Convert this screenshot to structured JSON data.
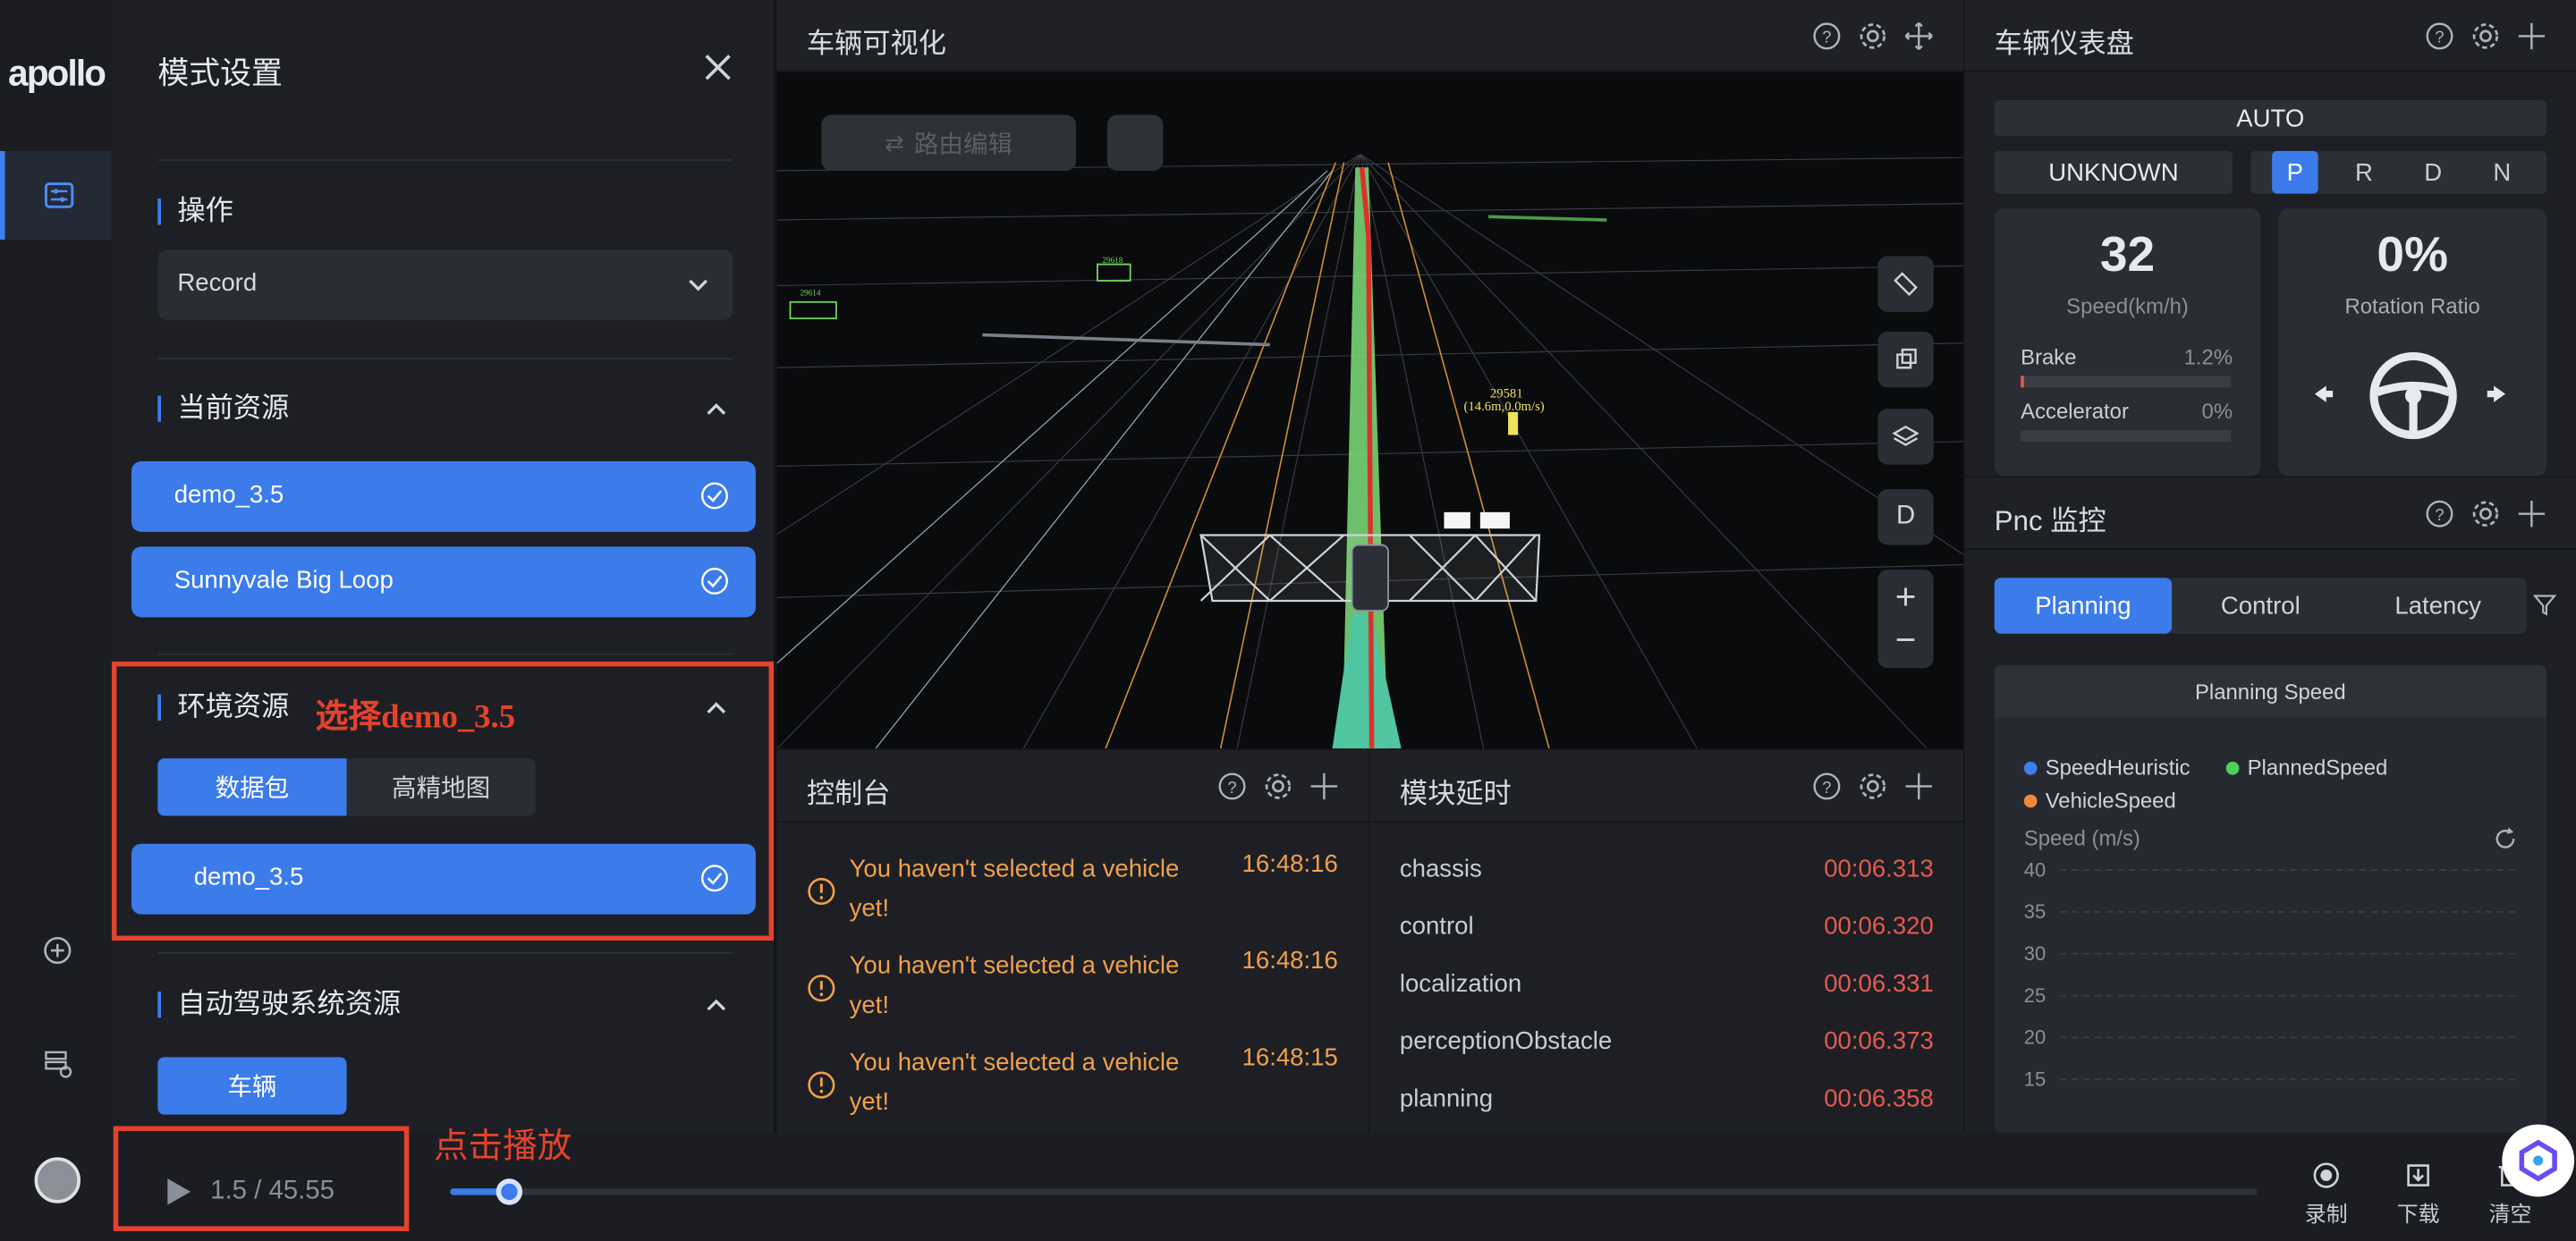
{
  "brand": {
    "logo": "apollo"
  },
  "mode_panel": {
    "title": "模式设置",
    "operation": {
      "title": "操作",
      "selected": "Record"
    },
    "current_resources": {
      "title": "当前资源",
      "items": [
        "demo_3.5",
        "Sunnyvale Big Loop"
      ]
    },
    "env_resources": {
      "title": "环境资源",
      "annotation": "选择demo_3.5",
      "tabs": [
        "数据包",
        "高精地图"
      ],
      "active_tab": "数据包",
      "items": [
        "demo_3.5"
      ]
    },
    "ads_resources": {
      "title": "自动驾驶系统资源",
      "button": "车辆"
    }
  },
  "vis": {
    "title": "车辆可视化",
    "route_edit": "路由编辑",
    "obstacle_label_1": "29581",
    "obstacle_label_2": "(14.6m,0.0m/s)",
    "obstacle_label_3": "29618",
    "obstacle_label_4": "29614",
    "view_button": "D"
  },
  "dashboard": {
    "title": "车辆仪表盘",
    "mode": "AUTO",
    "status": "UNKNOWN",
    "gears": [
      "P",
      "R",
      "D",
      "N"
    ],
    "active_gear": "P",
    "speed_value": "32",
    "speed_label": "Speed(km/h)",
    "brake_label": "Brake",
    "brake_value": "1.2%",
    "brake_level": 0.012,
    "accel_label": "Accelerator",
    "accel_value": "0%",
    "accel_level": 0,
    "rotation_value": "0%",
    "rotation_label": "Rotation Ratio"
  },
  "pnc": {
    "title": "Pnc 监控",
    "tabs": [
      "Planning",
      "Control",
      "Latency"
    ],
    "active_tab": "Planning",
    "chart_title": "Planning Speed",
    "legend": [
      "SpeedHeuristic",
      "PlannedSpeed",
      "VehicleSpeed"
    ],
    "colors": {
      "SpeedHeuristic": "#3d7ef0",
      "PlannedSpeed": "#4fcf5a",
      "VehicleSpeed": "#f08a3a"
    },
    "ylabel": "Speed (m/s)"
  },
  "chart_data": {
    "type": "line",
    "title": "Planning Speed",
    "ylabel": "Speed (m/s)",
    "yticks": [
      40,
      35,
      30,
      25,
      20,
      15
    ],
    "series": [
      {
        "name": "SpeedHeuristic",
        "values": []
      },
      {
        "name": "PlannedSpeed",
        "values": []
      },
      {
        "name": "VehicleSpeed",
        "values": []
      }
    ]
  },
  "console": {
    "title": "控制台",
    "messages": [
      {
        "text": "You haven't selected a vehicle yet!",
        "time": "16:48:16"
      },
      {
        "text": "You haven't selected a vehicle yet!",
        "time": "16:48:16"
      },
      {
        "text": "You haven't selected a vehicle yet!",
        "time": "16:48:15"
      }
    ]
  },
  "latency": {
    "title": "模块延时",
    "rows": [
      {
        "name": "chassis",
        "value": "00:06.313"
      },
      {
        "name": "control",
        "value": "00:06.320"
      },
      {
        "name": "localization",
        "value": "00:06.331"
      },
      {
        "name": "perceptionObstacle",
        "value": "00:06.373"
      },
      {
        "name": "planning",
        "value": "00:06.358"
      }
    ]
  },
  "player": {
    "annotation": "点击播放",
    "progress_text": "1.5 / 45.55",
    "current": 1.5,
    "total": 45.55,
    "progress": 0.033
  },
  "actions": {
    "record": "录制",
    "download": "下载",
    "clear": "清空"
  }
}
